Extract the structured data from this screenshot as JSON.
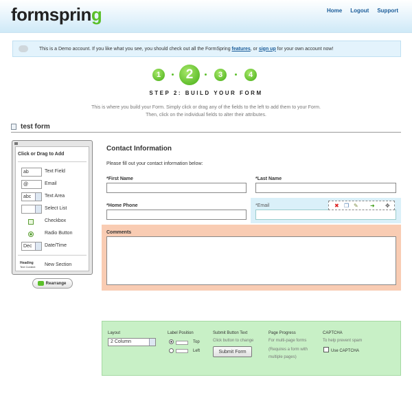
{
  "header": {
    "logo_text": "formsprin",
    "logo_accent": "g",
    "nav": [
      "Home",
      "Logout",
      "Support"
    ]
  },
  "demo_bar": {
    "text_before": "This is a Demo account. If you like what you see, you should check out all the FormSpring ",
    "link_features": "features",
    "text_middle": ", or ",
    "link_signup": "sign up",
    "text_after": " for your own account now!"
  },
  "steps": {
    "numbers": [
      "1",
      "2",
      "3",
      "4"
    ],
    "title": "STEP 2: BUILD YOUR FORM",
    "intro_line1": "This is where you build your Form. Simply click or drag any of the fields to the left to add them to your Form.",
    "intro_line2": "Then, click on the individual fields to alter their attributes."
  },
  "form_name": "test form",
  "palette": {
    "heading": "Click or Drag to Add",
    "items": [
      {
        "label": "Text Field",
        "preview": "ab"
      },
      {
        "label": "Email",
        "preview": "@"
      },
      {
        "label": "Text Area",
        "preview": "abc"
      },
      {
        "label": "Select List",
        "preview": ""
      },
      {
        "label": "Checkbox",
        "preview": ""
      },
      {
        "label": "Radio Button",
        "preview": ""
      },
      {
        "label": "Date/Time",
        "preview": "Dec"
      },
      {
        "label": "New Section",
        "preview_head": "Heading",
        "preview_sub": "Text Content"
      }
    ]
  },
  "rearrange_label": "Rearrange",
  "canvas": {
    "title": "Contact Information",
    "description": "Please fill out your contact information below:",
    "fields": {
      "first_name": "*First Name",
      "last_name": "*Last Name",
      "home_phone": "*Home Phone",
      "email": "*Email",
      "comments": "Comments"
    }
  },
  "settings": {
    "layout": {
      "label": "Layout",
      "value": "2 Column"
    },
    "label_position": {
      "label": "Label Position",
      "top": "Top",
      "left": "Left",
      "selected": "top"
    },
    "submit_text": {
      "label": "Submit Button Text",
      "hint": "Click button to change",
      "button": "Submit Form"
    },
    "page_progress": {
      "label": "Page Progress",
      "hint1": "For multi-page forms",
      "hint2": "(Requires a form with",
      "hint3": "multiple pages)"
    },
    "captcha": {
      "label": "CAPTCHA",
      "hint": "To help prevent spam",
      "checkbox_label": "Use CAPTCHA",
      "checked": false
    }
  },
  "colors": {
    "brand_green": "#5bbf2a",
    "link_blue": "#1a5c99",
    "selected_field": "#daf0f9",
    "active_section": "#f9ccb3",
    "settings_bg": "#c8f0c6"
  },
  "icons": [
    "speech-bubble-icon",
    "document-icon",
    "close-icon",
    "delete-icon",
    "copy-icon",
    "edit-icon",
    "move-down-icon",
    "move-icon",
    "rearrange-arrow-icon"
  ]
}
